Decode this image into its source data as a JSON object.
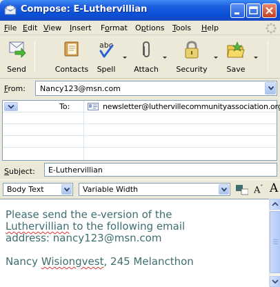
{
  "window": {
    "title": "Compose: E-Luthervillian",
    "icon": "compose-mail-icon",
    "controls": [
      "minimize-icon",
      "maximize-icon",
      "close-icon"
    ]
  },
  "menu": {
    "items": [
      {
        "label": "File"
      },
      {
        "label": "Edit"
      },
      {
        "label": "View"
      },
      {
        "label": "Insert"
      },
      {
        "label": "Format"
      },
      {
        "label": "Options"
      },
      {
        "label": "Tools"
      },
      {
        "label": "Help"
      }
    ]
  },
  "toolbar": {
    "send": "Send",
    "contacts": "Contacts",
    "spell": "Spell",
    "attach": "Attach",
    "security": "Security",
    "save": "Save"
  },
  "address": {
    "from_label": "From:",
    "from_value": "Nancy123@msn.com",
    "to_label": "To:",
    "to_value": "newsletter@luthervillecommunityassociation.org",
    "subject_label": "Subject:",
    "subject_value": "E-Luthervillian"
  },
  "format": {
    "paragraph_style": "Body Text",
    "font": "Variable Width",
    "text_color": "#3E6E6E",
    "smaller_font": "A",
    "larger_font": "A"
  },
  "body": {
    "lines": [
      "Please send the e-version of the",
      "Luthervillian to the following email",
      "address: nancy123@msn.com",
      "Nancy Wisiongvest, 245 Melancthon"
    ],
    "misspelled": [
      "Luthervillian",
      "Wisiongvest"
    ]
  },
  "colors": {
    "titlebar": "#0A50D8",
    "chrome": "#ECE9D8",
    "field_border": "#7F9DB9",
    "body_text": "#3E6E6E",
    "spell_underline": "#E03030"
  }
}
